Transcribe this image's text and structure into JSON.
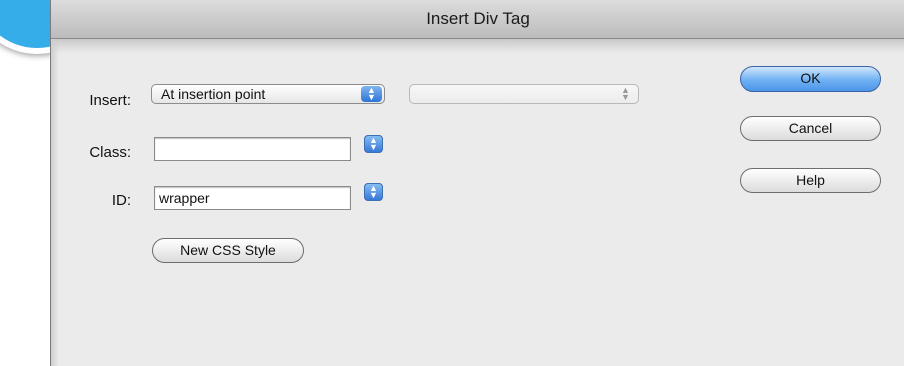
{
  "window": {
    "title": "Insert Div Tag"
  },
  "form": {
    "insert": {
      "label": "Insert:",
      "selected": "At insertion point",
      "secondary_selected": ""
    },
    "class": {
      "label": "Class:",
      "value": ""
    },
    "id": {
      "label": "ID:",
      "value": "wrapper"
    },
    "new_css_style_label": "New CSS Style"
  },
  "buttons": {
    "ok": "OK",
    "cancel": "Cancel",
    "help": "Help"
  },
  "icons": {
    "badge": "blue-circle-badge",
    "popup_arrows": "up-down-arrows-icon"
  },
  "colors": {
    "accent": "#35ade8",
    "default_button": "#5ba1ed",
    "window_bg": "#ebebeb"
  }
}
